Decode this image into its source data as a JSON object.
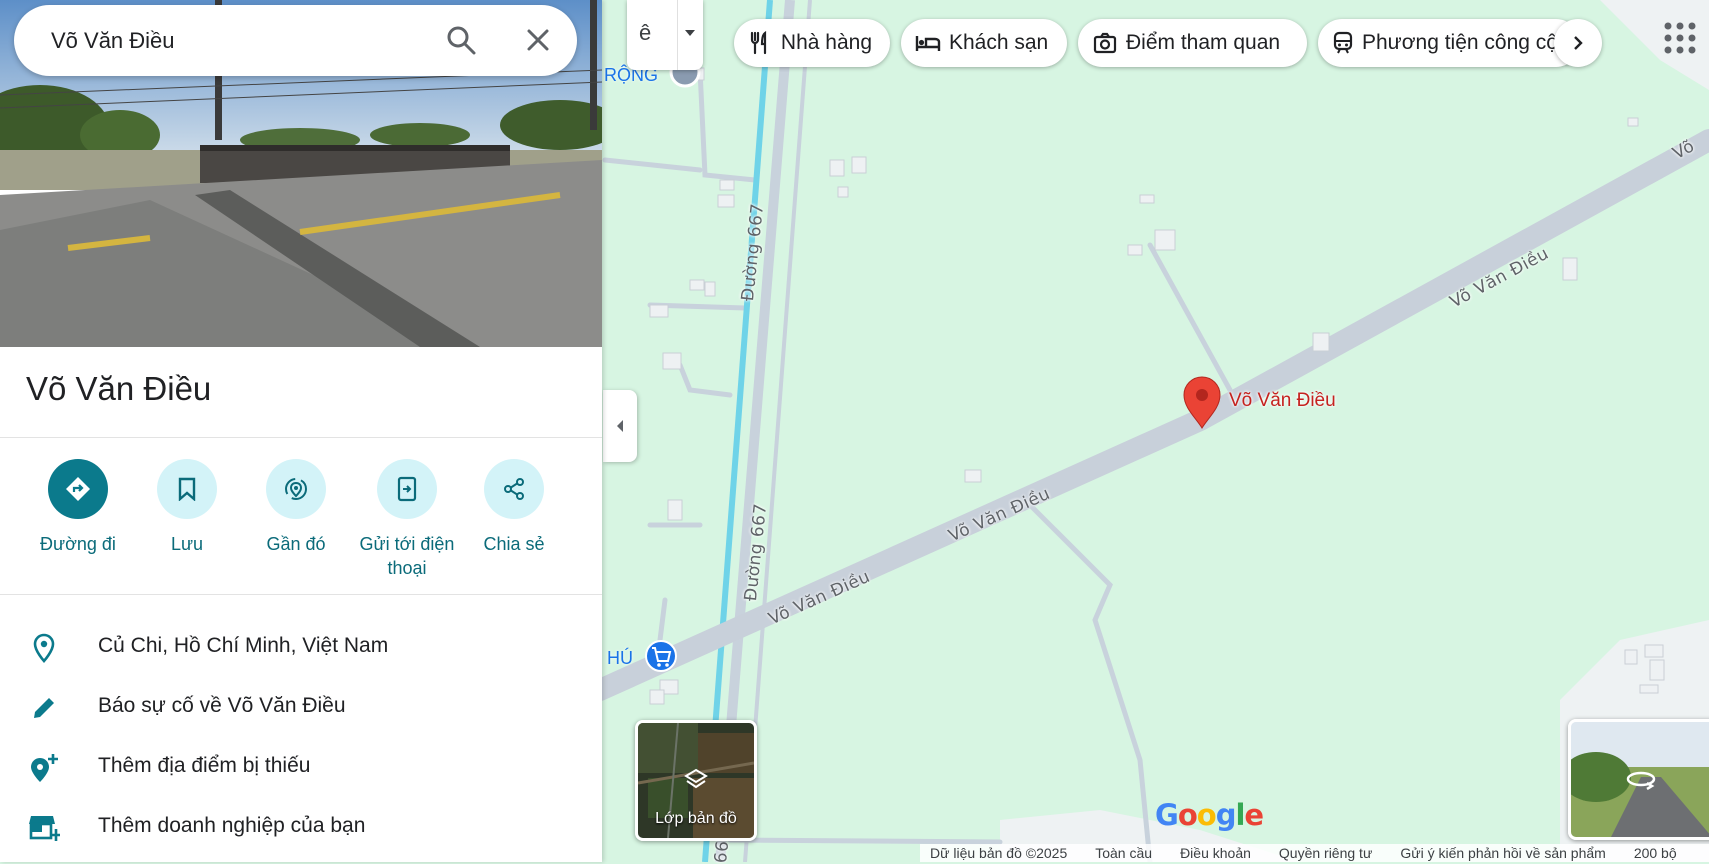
{
  "search": {
    "value": "Võ Văn Điều"
  },
  "place": {
    "title": "Võ Văn Điều"
  },
  "actions": [
    {
      "label": "Đường đi"
    },
    {
      "label": "Lưu"
    },
    {
      "label": "Gần đó"
    },
    {
      "label": "Gửi tới điện thoại"
    },
    {
      "label": "Chia sẻ"
    }
  ],
  "info": [
    {
      "text": "Củ Chi, Hồ Chí Minh, Việt Nam",
      "icon": "location-pin-icon"
    },
    {
      "text": "Báo sự cố về Võ Văn Điều",
      "icon": "pencil-icon"
    },
    {
      "text": "Thêm địa điểm bị thiếu",
      "icon": "add-location-icon"
    },
    {
      "text": "Thêm doanh nghiệp của bạn",
      "icon": "add-business-icon"
    }
  ],
  "chips": [
    {
      "label": "Nhà hàng",
      "icon": "restaurant-icon"
    },
    {
      "label": "Khách sạn",
      "icon": "hotel-icon"
    },
    {
      "label": "Điểm tham quan",
      "icon": "camera-icon"
    },
    {
      "label": "Phương tiện công cộng",
      "icon": "train-icon"
    }
  ],
  "map": {
    "marker_label": "Võ Văn Điều",
    "road_labels": [
      "Võ Văn Điều",
      "Võ Văn Điều",
      "Võ Văn Điều",
      "Võ Văn Điều",
      "Võ"
    ],
    "side_road_labels": [
      "Đường 667",
      "Đường 667",
      "667"
    ],
    "poi_labels": [
      "RỘNG",
      "HÚ"
    ],
    "layers_label": "Lớp bản đồ",
    "top_switch_glyph": "ê",
    "logo": "Google"
  },
  "footer": {
    "data": "Dữ liệu bản đồ ©2025",
    "global": "Toàn cầu",
    "terms": "Điều khoản",
    "privacy": "Quyền riêng tư",
    "feedback": "Gửi ý kiến phản hồi về sản phẩm",
    "scale": "200 bộ"
  },
  "colors": {
    "map_bg": "#d7f5e2",
    "road": "#c5cdd8",
    "canal": "#6fd3e8",
    "accent": "#0b7a8c",
    "marker": "#ea4335"
  }
}
